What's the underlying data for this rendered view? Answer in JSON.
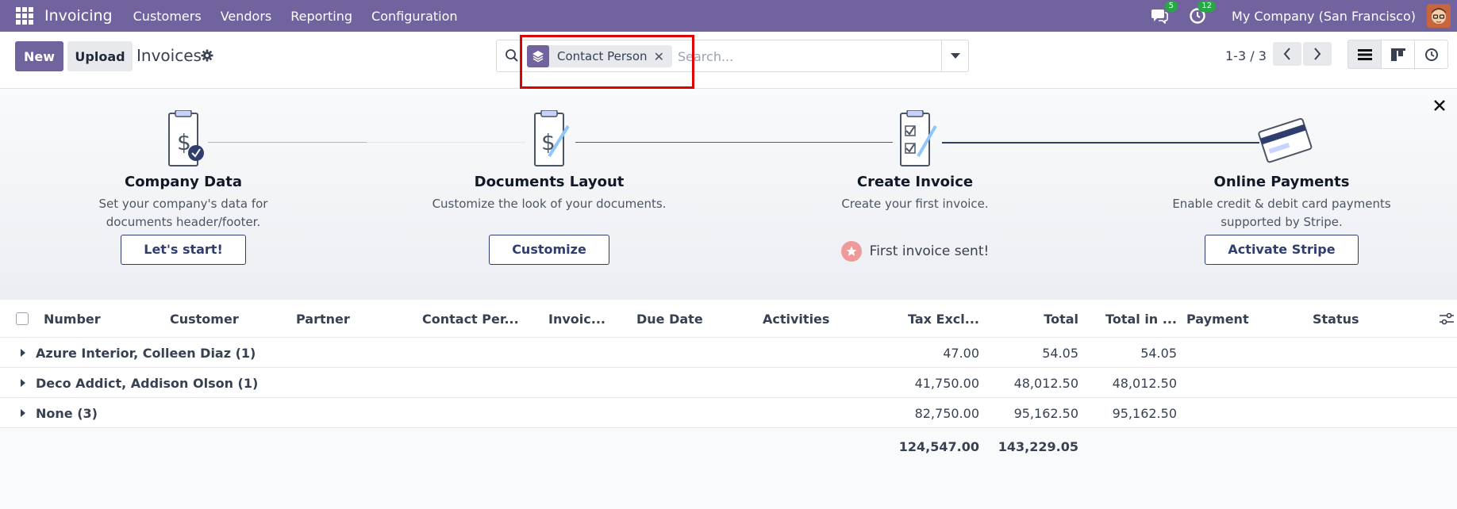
{
  "navbar": {
    "brand": "Invoicing",
    "menu": [
      "Customers",
      "Vendors",
      "Reporting",
      "Configuration"
    ],
    "messages_count": "5",
    "activities_count": "12",
    "company": "My Company (San Francisco)"
  },
  "control": {
    "new_label": "New",
    "upload_label": "Upload",
    "title": "Invoices",
    "facet_label": "Contact Person",
    "search_placeholder": "Search...",
    "pager": "1-3 / 3"
  },
  "onboarding": {
    "steps": [
      {
        "title": "Company Data",
        "desc": "Set your company's data for documents header/footer.",
        "button": "Let's start!"
      },
      {
        "title": "Documents Layout",
        "desc": "Customize the look of your documents.",
        "button": "Customize"
      },
      {
        "title": "Create Invoice",
        "desc": "Create your first invoice.",
        "done": "First invoice sent!"
      },
      {
        "title": "Online Payments",
        "desc": "Enable credit & debit card payments supported by Stripe.",
        "button": "Activate Stripe"
      }
    ]
  },
  "table": {
    "columns": [
      "Number",
      "Customer",
      "Partner",
      "Contact Per...",
      "Invoic...",
      "Due Date",
      "Activities",
      "Tax Excl...",
      "Total",
      "Total in ...",
      "Payment",
      "Status"
    ],
    "groups": [
      {
        "label": "Azure Interior, Colleen Diaz (1)",
        "tax_excl": "47.00",
        "total": "54.05",
        "total_currency": "54.05"
      },
      {
        "label": "Deco Addict, Addison Olson (1)",
        "tax_excl": "41,750.00",
        "total": "48,012.50",
        "total_currency": "48,012.50"
      },
      {
        "label": "None (3)",
        "tax_excl": "82,750.00",
        "total": "95,162.50",
        "total_currency": "95,162.50"
      }
    ],
    "totals": {
      "tax_excl": "124,547.00",
      "total": "143,229.05"
    }
  },
  "colors": {
    "brand": "#71639e",
    "highlight": "#e00000",
    "accent_dark": "#2f3e6e"
  }
}
